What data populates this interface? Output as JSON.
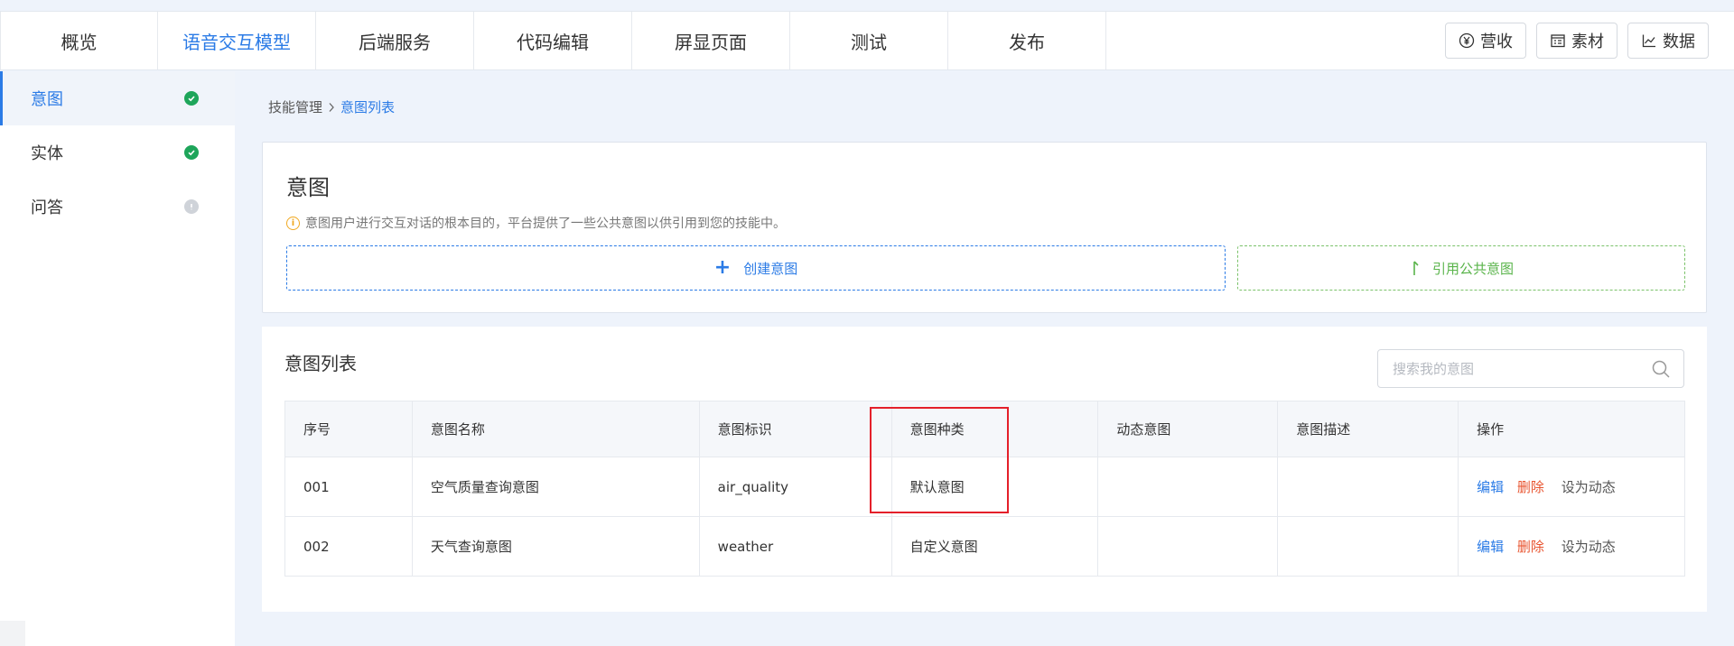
{
  "topnav": {
    "tabs": [
      "概览",
      "语音交互模型",
      "后端服务",
      "代码编辑",
      "屏显页面",
      "测试",
      "发布"
    ],
    "active_index": 1,
    "tools": {
      "revenue": "营收",
      "material": "素材",
      "data": "数据"
    },
    "accent_color": "#2b7be6"
  },
  "sidebar": {
    "items": [
      {
        "label": "意图",
        "status": "done"
      },
      {
        "label": "实体",
        "status": "done"
      },
      {
        "label": "问答",
        "status": "pending"
      }
    ]
  },
  "breadcrumb": {
    "parent": "技能管理",
    "current": "意图列表"
  },
  "intent_card": {
    "title": "意图",
    "description": "意图用户进行交互对话的根本目的，平台提供了一些公共意图以供引用到您的技能中。",
    "create_label": "创建意图",
    "reference_label": "引用公共意图"
  },
  "list_card": {
    "title": "意图列表",
    "search_placeholder": "搜索我的意图",
    "columns": [
      "序号",
      "意图名称",
      "意图标识",
      "意图种类",
      "动态意图",
      "意图描述",
      "操作"
    ],
    "rows": [
      {
        "no": "001",
        "name": "空气质量查询意图",
        "id": "air_quality",
        "kind": "默认意图",
        "dynamic": "",
        "desc": ""
      },
      {
        "no": "002",
        "name": "天气查询意图",
        "id": "weather",
        "kind": "自定义意图",
        "dynamic": "",
        "desc": ""
      }
    ],
    "actions": {
      "edit": "编辑",
      "delete": "删除",
      "set_dynamic": "设为动态"
    }
  }
}
